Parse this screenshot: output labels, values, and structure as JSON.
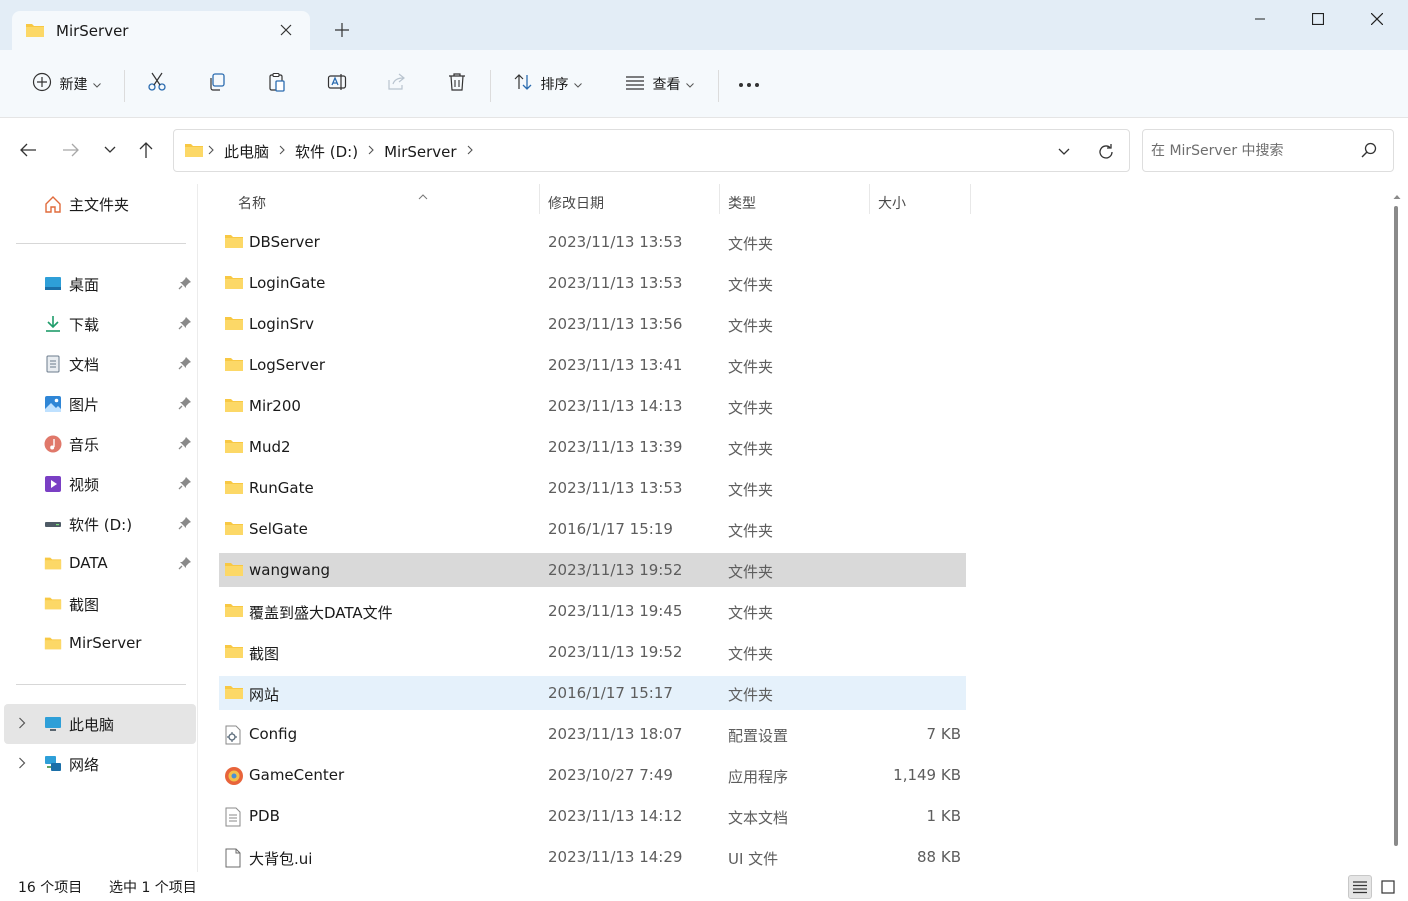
{
  "window": {
    "tab_title": "MirServer"
  },
  "toolbar": {
    "new_label": "新建",
    "sort_label": "排序",
    "view_label": "查看"
  },
  "address": {
    "crumbs": [
      "此电脑",
      "软件 (D:)",
      "MirServer"
    ],
    "search_placeholder": "在 MirServer 中搜索"
  },
  "sidebar": {
    "home": "主文件夹",
    "pinned": [
      {
        "label": "桌面",
        "icon": "desktop-icon"
      },
      {
        "label": "下载",
        "icon": "download-icon"
      },
      {
        "label": "文档",
        "icon": "document-icon"
      },
      {
        "label": "图片",
        "icon": "pictures-icon"
      },
      {
        "label": "音乐",
        "icon": "music-icon"
      },
      {
        "label": "视频",
        "icon": "video-icon"
      },
      {
        "label": "软件 (D:)",
        "icon": "drive-icon"
      },
      {
        "label": "DATA",
        "icon": "folder-icon"
      }
    ],
    "recent": [
      {
        "label": "截图",
        "icon": "folder-icon"
      },
      {
        "label": "MirServer",
        "icon": "folder-icon"
      }
    ],
    "this_pc": "此电脑",
    "network": "网络"
  },
  "columns": {
    "name": "名称",
    "date": "修改日期",
    "type": "类型",
    "size": "大小"
  },
  "files": [
    {
      "name": "DBServer",
      "date": "2023/11/13 13:53",
      "type": "文件夹",
      "size": "",
      "icon": "folder"
    },
    {
      "name": "LoginGate",
      "date": "2023/11/13 13:53",
      "type": "文件夹",
      "size": "",
      "icon": "folder"
    },
    {
      "name": "LoginSrv",
      "date": "2023/11/13 13:56",
      "type": "文件夹",
      "size": "",
      "icon": "folder"
    },
    {
      "name": "LogServer",
      "date": "2023/11/13 13:41",
      "type": "文件夹",
      "size": "",
      "icon": "folder"
    },
    {
      "name": "Mir200",
      "date": "2023/11/13 14:13",
      "type": "文件夹",
      "size": "",
      "icon": "folder"
    },
    {
      "name": "Mud2",
      "date": "2023/11/13 13:39",
      "type": "文件夹",
      "size": "",
      "icon": "folder"
    },
    {
      "name": "RunGate",
      "date": "2023/11/13 13:53",
      "type": "文件夹",
      "size": "",
      "icon": "folder"
    },
    {
      "name": "SelGate",
      "date": "2016/1/17 15:19",
      "type": "文件夹",
      "size": "",
      "icon": "folder"
    },
    {
      "name": "wangwang",
      "date": "2023/11/13 19:52",
      "type": "文件夹",
      "size": "",
      "icon": "folder"
    },
    {
      "name": "覆盖到盛大DATA文件",
      "date": "2023/11/13 19:45",
      "type": "文件夹",
      "size": "",
      "icon": "folder"
    },
    {
      "name": "截图",
      "date": "2023/11/13 19:52",
      "type": "文件夹",
      "size": "",
      "icon": "folder"
    },
    {
      "name": "网站",
      "date": "2016/1/17 15:17",
      "type": "文件夹",
      "size": "",
      "icon": "folder"
    },
    {
      "name": "Config",
      "date": "2023/11/13 18:07",
      "type": "配置设置",
      "size": "7 KB",
      "icon": "config"
    },
    {
      "name": "GameCenter",
      "date": "2023/10/27 7:49",
      "type": "应用程序",
      "size": "1,149 KB",
      "icon": "app"
    },
    {
      "name": "PDB",
      "date": "2023/11/13 14:12",
      "type": "文本文档",
      "size": "1 KB",
      "icon": "text"
    },
    {
      "name": "大背包.ui",
      "date": "2023/11/13 14:29",
      "type": "UI 文件",
      "size": "88 KB",
      "icon": "file"
    }
  ],
  "selected_file": "wangwang",
  "hovered_file": "网站",
  "status": {
    "count": "16 个项目",
    "selected": "选中 1 个项目"
  },
  "colors": {
    "title_bg": "#e3edf6",
    "toolbar_bg": "#f5f9fc",
    "folder": "#f8c843",
    "selection": "#d9d9d9",
    "hover": "#e5f1fb"
  }
}
